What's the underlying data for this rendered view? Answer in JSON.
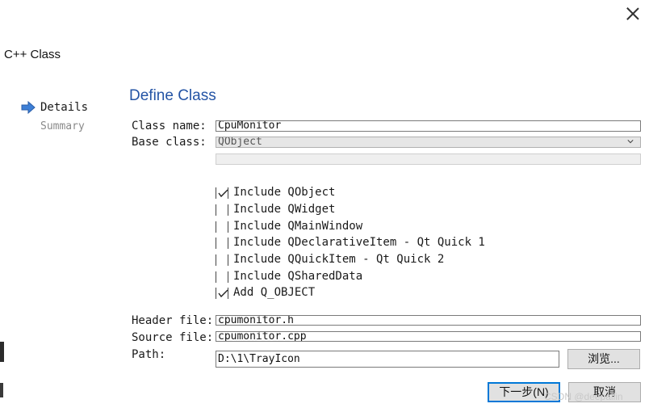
{
  "window": {
    "title": "C++ Class"
  },
  "steps": [
    {
      "label": "Details",
      "active": true
    },
    {
      "label": "Summary",
      "active": false
    }
  ],
  "page": {
    "heading": "Define Class"
  },
  "fields": {
    "class_name_label": "Class name:",
    "class_name_value": "CpuMonitor",
    "base_class_label": "Base class:",
    "base_class_value": "QObject",
    "header_file_label": "Header file:",
    "header_file_value": "cpumonitor.h",
    "source_file_label": "Source file:",
    "source_file_value": "cpumonitor.cpp",
    "path_label": "Path:",
    "path_value": "D:\\1\\TrayIcon"
  },
  "options": [
    {
      "label": "Include QObject",
      "checked": true
    },
    {
      "label": "Include QWidget",
      "checked": false
    },
    {
      "label": "Include QMainWindow",
      "checked": false
    },
    {
      "label": "Include QDeclarativeItem - Qt Quick 1",
      "checked": false
    },
    {
      "label": "Include QQuickItem - Qt Quick 2",
      "checked": false
    },
    {
      "label": "Include QSharedData",
      "checked": false
    },
    {
      "label": "Add Q_OBJECT",
      "checked": true
    }
  ],
  "buttons": {
    "browse": "浏览...",
    "next": "下一步(N)",
    "cancel": "取消"
  },
  "watermark": "CSDN @deepallin",
  "colors": {
    "heading": "#2454a5",
    "focus_border": "#0078d7",
    "step_arrow": "#3d7fd6"
  }
}
